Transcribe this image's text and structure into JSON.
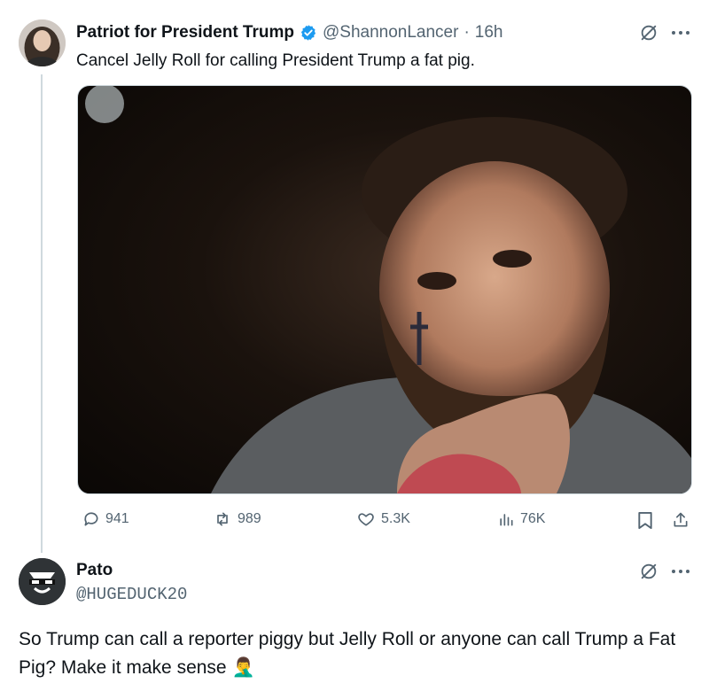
{
  "tweet1": {
    "display_name": "Patriot for President Trump",
    "handle": "@ShannonLancer",
    "separator": "·",
    "time": "16h",
    "text": "Cancel Jelly Roll for calling President Trump a fat pig.",
    "verified": true,
    "stats": {
      "replies": "941",
      "reposts": "989",
      "likes": "5.3K",
      "views": "76K"
    }
  },
  "tweet2": {
    "display_name": "Pato",
    "handle": "@HUGEDUCK20",
    "text": "So Trump can call a reporter piggy but Jelly Roll or anyone can call Trump a Fat Pig? Make it make sense",
    "emoji": "🤦‍♂️"
  },
  "icons": {
    "more": "more-icon",
    "grok": "grok-icon",
    "reply": "reply-icon",
    "repost": "repost-icon",
    "like": "like-icon",
    "views": "views-icon",
    "bookmark": "bookmark-icon",
    "share": "share-icon"
  },
  "colors": {
    "verified": "#1d9bf0",
    "muted": "#536471",
    "line": "#cfd9de"
  }
}
